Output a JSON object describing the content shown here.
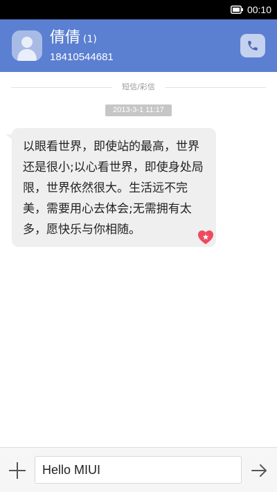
{
  "status_bar": {
    "time": "00:10",
    "icons": [
      "battery-icon"
    ]
  },
  "header": {
    "contact_name": "倩倩",
    "unread_count": "(1)",
    "phone_number": "18410544681",
    "icons": [
      "avatar-person-icon",
      "phone-icon"
    ]
  },
  "conversation": {
    "divider_label": "短信/彩信",
    "timestamp": "2013-3-1 11:17",
    "messages": [
      {
        "text": "以眼看世界，即使站的最高，世界还是很小;以心看世界，即使身处局限，世界依然很大。生活远不完美，需要用心去体会;无需拥有太多，愿快乐与你相随。",
        "icon": "favorite-star-heart-icon"
      }
    ]
  },
  "compose": {
    "input_value": "Hello MIUI",
    "icons": [
      "plus-icon",
      "send-arrow-icon"
    ]
  },
  "colors": {
    "header_background": "#5b7fd1",
    "bubble_background": "#efefef",
    "favorite_badge": "#ee4b5f",
    "timestamp_background": "#c6c6c6"
  }
}
